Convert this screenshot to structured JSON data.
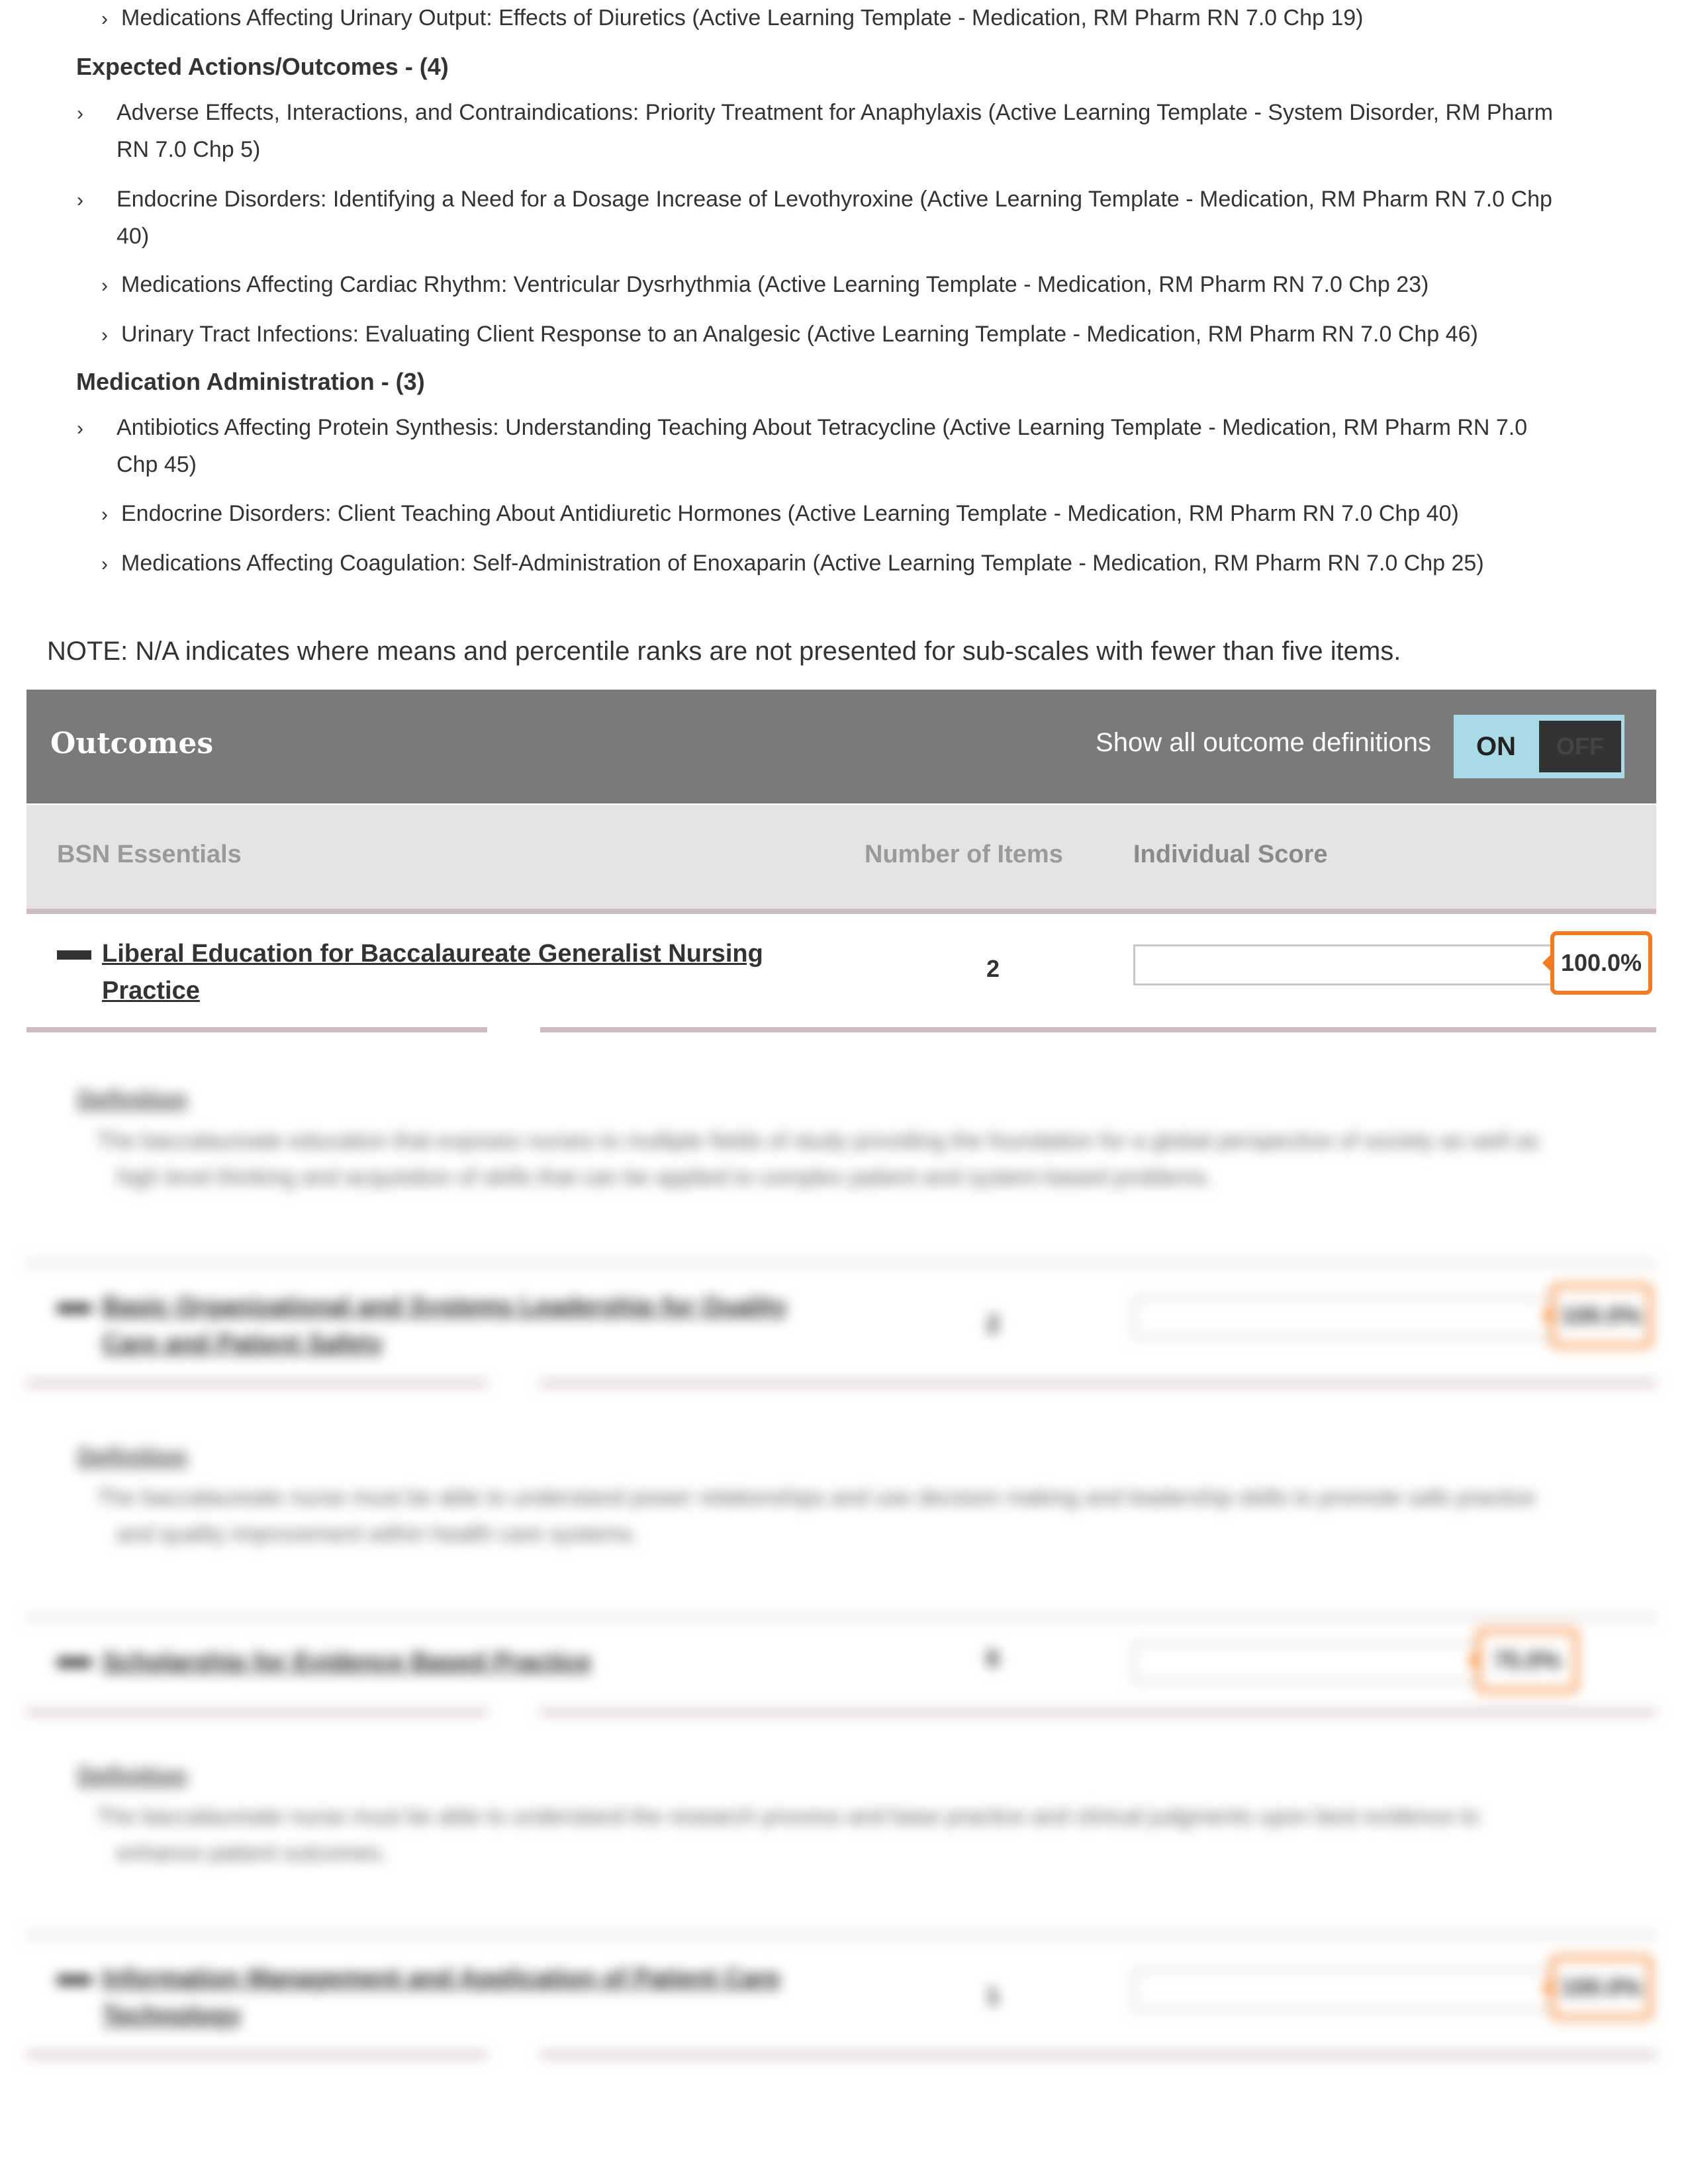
{
  "topics": {
    "item_top": "Medications Affecting Urinary Output: Effects of Diuretics (Active Learning Template - Medication, RM Pharm RN 7.0 Chp 19)",
    "groups": [
      {
        "heading": "Expected Actions/Outcomes - (4)",
        "items": [
          "Adverse Effects, Interactions, and Contraindications: Priority Treatment for Anaphylaxis (Active Learning Template - System Disorder, RM Pharm RN 7.0 Chp 5)",
          "Endocrine Disorders: Identifying a Need for a Dosage Increase of Levothyroxine (Active Learning Template - Medication, RM Pharm RN 7.0 Chp 40)",
          "Medications Affecting Cardiac Rhythm: Ventricular Dysrhythmia (Active Learning Template - Medication, RM Pharm RN 7.0 Chp 23)",
          "Urinary Tract Infections: Evaluating Client Response to an Analgesic (Active Learning Template - Medication, RM Pharm RN 7.0 Chp 46)"
        ]
      },
      {
        "heading": "Medication Administration - (3)",
        "items": [
          "Antibiotics Affecting Protein Synthesis: Understanding Teaching About Tetracycline (Active Learning Template - Medication, RM Pharm RN 7.0 Chp 45)",
          "Endocrine Disorders: Client Teaching About Antidiuretic Hormones (Active Learning Template - Medication, RM Pharm RN 7.0 Chp 40)",
          "Medications Affecting Coagulation: Self-Administration of Enoxaparin (Active Learning Template - Medication, RM Pharm RN 7.0 Chp 25)"
        ]
      }
    ],
    "chevron": "›"
  },
  "note": "NOTE: N/A indicates where means and percentile ranks are not presented for sub-scales with fewer than five items.",
  "outcomes": {
    "title": "Outcomes",
    "toggle_label": "Show all outcome definitions",
    "toggle_on": "ON",
    "toggle_off": "OFF",
    "toggle_state": "on",
    "columns": [
      "BSN Essentials",
      "Number of Items",
      "Individual Score"
    ],
    "accent_color": "#f47b20",
    "rows": [
      {
        "name": "Liberal Education for Baccalaureate Generalist Nursing Practice",
        "items": "2",
        "score": "100.0%",
        "score_value": 100,
        "definition_heading": "Definition",
        "definition": "The baccalaureate education that exposes nurses to multiple fields of study providing the foundation for a global perspective of society as well as high level thinking and acquisition of skills that can be applied to complex patient and system-based problems."
      },
      {
        "name": "Basic Organizational and Systems Leadership for Quality Care and Patient Safety",
        "items": "2",
        "score": "100.0%",
        "score_value": 100,
        "definition_heading": "Definition",
        "definition": "The baccalaureate nurse must be able to understand power relationships and use decision making and leadership skills to promote safe practice and quality improvement within health care systems."
      },
      {
        "name": "Scholarship for Evidence Based Practice",
        "items": "6",
        "score": "75.0%",
        "score_value": 75,
        "definition_heading": "Definition",
        "definition": "The baccalaureate nurse must be able to understand the research process and base practice and clinical judgments upon best evidence to enhance patient outcomes."
      },
      {
        "name": "Information Management and Application of Patient Care Technology",
        "items": "1",
        "score": "100.0%",
        "score_value": 100
      }
    ]
  }
}
